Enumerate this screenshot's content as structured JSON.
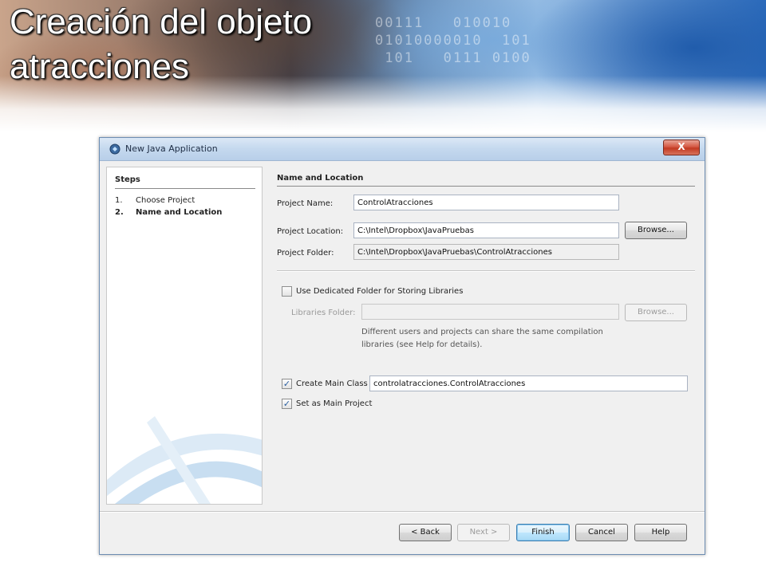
{
  "slide": {
    "title_line1": "Creación del objeto",
    "title_line2": "atracciones",
    "banner_digits": "00111   010010\n01010000010  101\n 101   0111 0100"
  },
  "dialog": {
    "title": "New Java Application",
    "close_label": "X",
    "steps": {
      "header": "Steps",
      "items": [
        {
          "num": "1.",
          "label": "Choose Project"
        },
        {
          "num": "2.",
          "label": "Name and Location"
        }
      ]
    },
    "section_title": "Name and Location",
    "project_name": {
      "label": "Project Name:",
      "value": "ControlAtracciones"
    },
    "project_location": {
      "label": "Project Location:",
      "value": "C:\\Intel\\Dropbox\\JavaPruebas"
    },
    "project_folder": {
      "label": "Project Folder:",
      "value": "C:\\Intel\\Dropbox\\JavaPruebas\\ControlAtracciones"
    },
    "browse_label": "Browse...",
    "dedicated_folder": {
      "label": "Use Dedicated Folder for Storing Libraries",
      "checked": false
    },
    "libraries_folder": {
      "label": "Libraries Folder:",
      "value": ""
    },
    "browse2_label": "Browse...",
    "libraries_description": "Different users and projects can share the same compilation libraries (see Help for details).",
    "create_main_class": {
      "label": "Create Main Class",
      "checked": true,
      "value": "controlatracciones.ControlAtracciones"
    },
    "set_main_project": {
      "label": "Set as Main Project",
      "checked": true
    },
    "check_mark": "✓",
    "buttons": {
      "back": "< Back",
      "next": "Next >",
      "finish": "Finish",
      "cancel": "Cancel",
      "help": "Help"
    }
  },
  "colors": {
    "titlebar": "#c4d8ee",
    "dialog_bg": "#f0f0f0",
    "close_button": "#c23a22",
    "default_button": "#3c7fb1"
  }
}
